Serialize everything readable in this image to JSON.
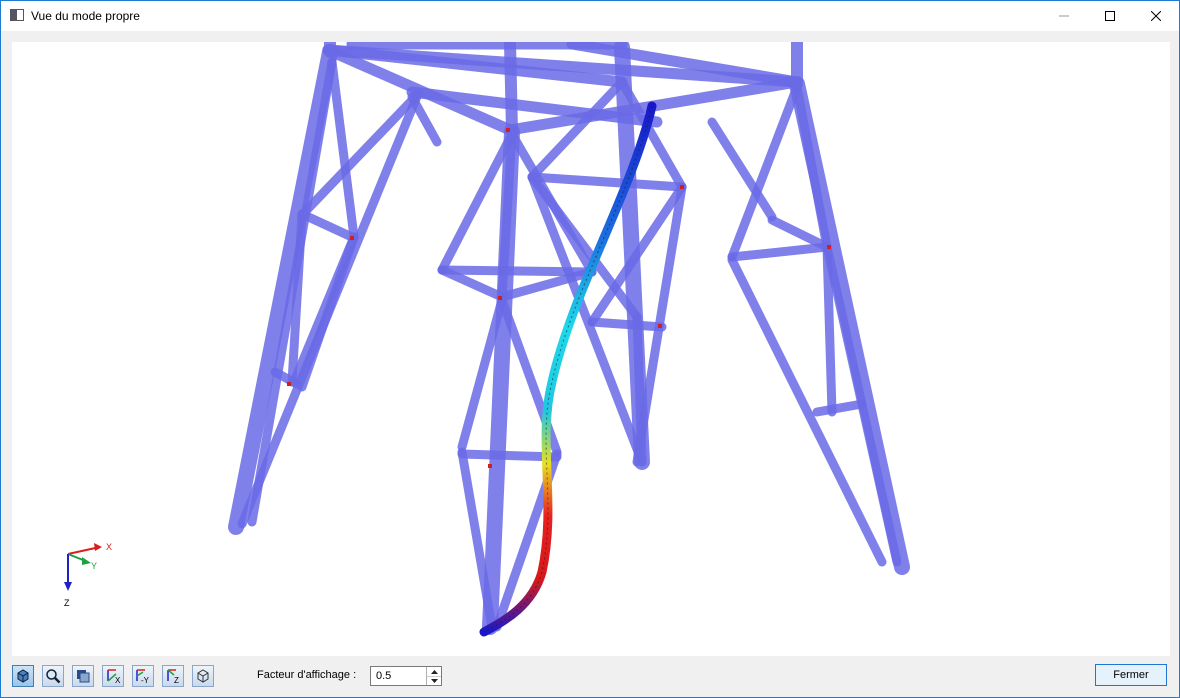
{
  "window": {
    "title": "Vue du mode propre"
  },
  "axes_triad": {
    "x_label": "X",
    "y_label": "Y",
    "z_label": "Z"
  },
  "toolbar": {
    "buttons": [
      {
        "icon": "view-mode-icon"
      },
      {
        "icon": "zoom-icon"
      },
      {
        "icon": "render-mode-icon"
      },
      {
        "icon": "view-x-icon",
        "label": "X"
      },
      {
        "icon": "view-neg-y-icon",
        "label": "-Y"
      },
      {
        "icon": "view-z-icon",
        "label": "Z"
      },
      {
        "icon": "isometric-view-icon"
      }
    ],
    "factor_label": "Facteur d'affichage :",
    "factor_value": "0.5",
    "close_label": "Fermer"
  },
  "colors": {
    "member": "#6a6ae6",
    "title_border": "#1d7bd4",
    "mode_low": "#1818c8",
    "mode_mid": "#20d8e8",
    "mode_high": "#e82020"
  }
}
